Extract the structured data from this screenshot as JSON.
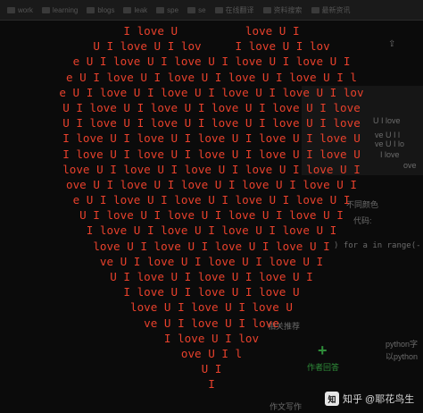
{
  "bookmarks": [
    "work",
    "learning",
    "blogs",
    "leak",
    "spe",
    "se",
    "在线翻译",
    "资料搜索",
    "最新资讯"
  ],
  "background_text": {
    "right_lines": [
      "U I love",
      "ve U I l",
      "ve U I lo",
      "I love",
      "ove"
    ],
    "mid_1": "不同颜色",
    "mid_2": "代码:",
    "code": ") for a in range(-",
    "side_1": "python字",
    "side_2": "以python",
    "rec": "相关推荐",
    "bottom": "作者回答",
    "bottom_left": "作文写作"
  },
  "heart_lines": [
    "I love U          love U I",
    "U I love U I lov     I love U I lov",
    "e U I love U I love U I love U I love U I",
    "e U I love U I love U I love U I love U I l",
    "e U I love U I love U I love U I love U I lov",
    "U I love U I love U I love U I love U I love",
    "U I love U I love U I love U I love U I love",
    "I love U I love U I love U I love U I love U",
    "I love U I love U I love U I love U I love U",
    "love U I love U I love U I love U I love U I",
    "ove U I love U I love U I love U I love U I",
    "e U I love U I love U I love U I love U I",
    "U I love U I love U I love U I love U I",
    "I love U I love U I love U I love U I",
    "love U I love U I love U I love U I",
    "ve U I love U I love U I love U I",
    "U I love U I love U I love U I",
    "I love U I love U I love U",
    "love U I love U I love U",
    "ve U I love U I love",
    "I love U I lov",
    "ove U I l",
    "U I",
    "I"
  ],
  "watermark": {
    "logo": "知",
    "text": "知乎 @耶花鸟生"
  },
  "colors": {
    "heart": "#e8412c",
    "background": "#0b0b0b"
  }
}
